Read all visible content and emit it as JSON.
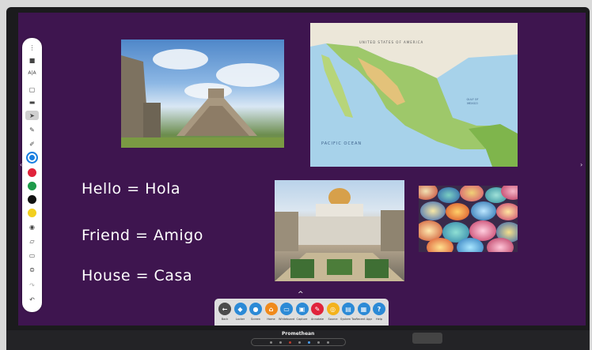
{
  "brand": "Promethean",
  "phrases": [
    {
      "text": "Hello = Hola"
    },
    {
      "text": "Friend = Amigo"
    },
    {
      "text": "House = Casa"
    }
  ],
  "map_labels": {
    "country_top": "UNITED STATES OF AMERICA",
    "ocean": "PACIFIC OCEAN",
    "gulf": "GULF OF MEXICO"
  },
  "toolbar": {
    "items": [
      "more-icon",
      "save-icon",
      "text-icon",
      "clipboard-icon",
      "folder-icon",
      "select-icon",
      "pen-icon",
      "marker-icon"
    ],
    "colors": [
      "#1a7fe0",
      "#e0233b",
      "#1d9a4a",
      "#111111",
      "#f2cf1f"
    ],
    "items_lower": [
      "palette-icon",
      "eraser-icon",
      "tag-icon",
      "stamp-icon",
      "redo-icon",
      "undo-icon"
    ]
  },
  "taskbar": {
    "buttons": [
      {
        "label": "Back",
        "icon": "back-icon",
        "color": "#4c4c4c",
        "glyph": "←"
      },
      {
        "label": "Locker",
        "icon": "locker-icon",
        "color": "#2c8ad6",
        "glyph": "◆"
      },
      {
        "label": "Screen",
        "icon": "screen-icon",
        "color": "#2c8ad6",
        "glyph": "●"
      },
      {
        "label": "Home",
        "icon": "home-icon",
        "color": "#f08a1c",
        "glyph": "⌂"
      },
      {
        "label": "Whiteboard",
        "icon": "whiteboard-icon",
        "color": "#2c8ad6",
        "glyph": "▭"
      },
      {
        "label": "Capture",
        "icon": "capture-icon",
        "color": "#2c8ad6",
        "glyph": "▣"
      },
      {
        "label": "Annotate",
        "icon": "annotate-icon",
        "color": "#e0233b",
        "glyph": "✎"
      },
      {
        "label": "Source",
        "icon": "source-icon",
        "color": "#f3b21c",
        "glyph": "◎"
      },
      {
        "label": "System Tools",
        "icon": "system-tools-icon",
        "color": "#2c8ad6",
        "glyph": "▤"
      },
      {
        "label": "Recent Apps",
        "icon": "recent-apps-icon",
        "color": "#2c8ad6",
        "glyph": "▦"
      },
      {
        "label": "Help",
        "icon": "help-icon",
        "color": "#2c8ad6",
        "glyph": "?"
      }
    ]
  }
}
